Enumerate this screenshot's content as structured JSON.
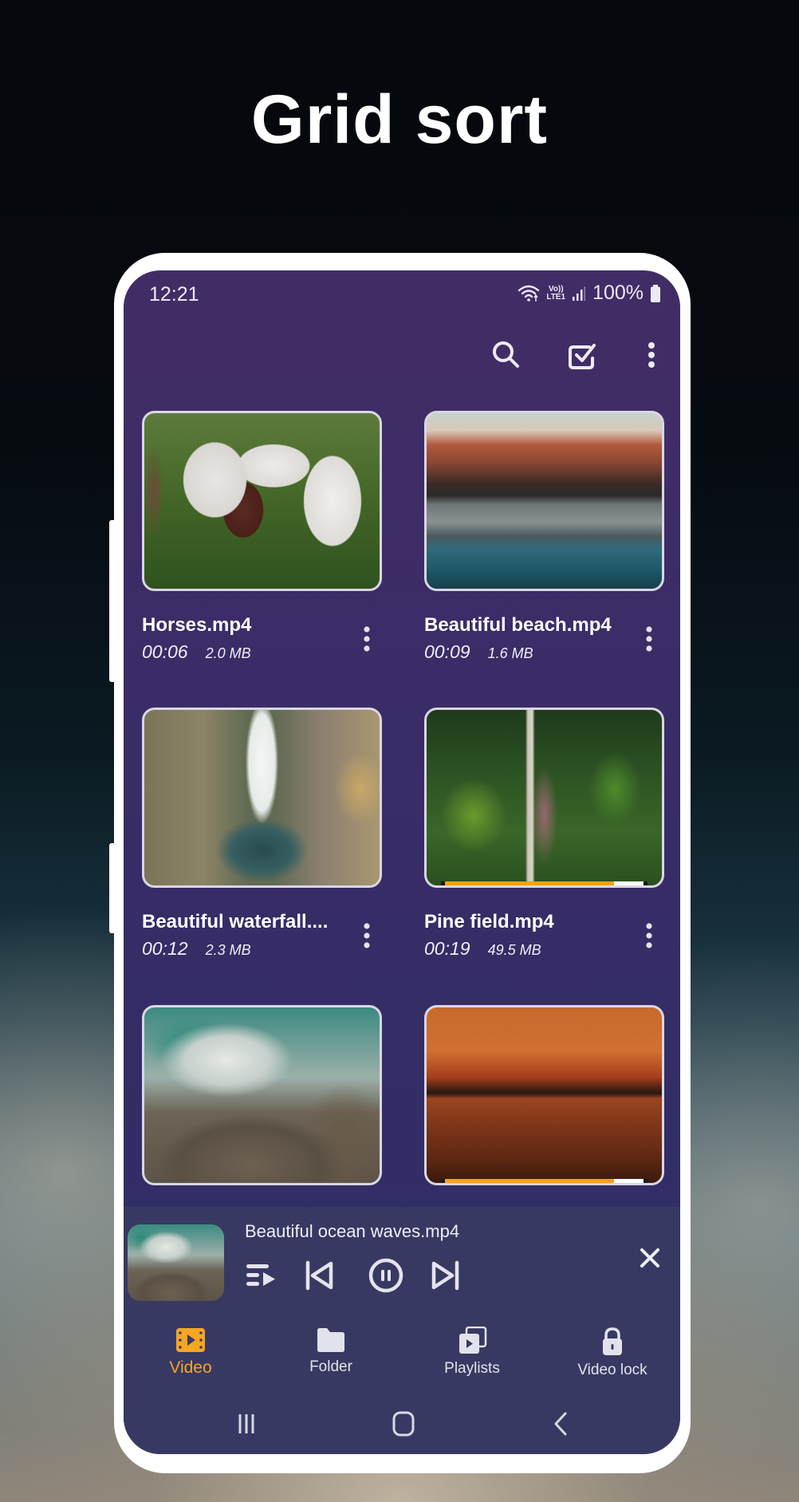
{
  "headline": "Grid sort",
  "status_bar": {
    "time": "12:21",
    "network_label_top": "Vo))",
    "network_label_bottom": "LTE1",
    "battery": "100%"
  },
  "toolbar": {
    "icons": [
      "search-icon",
      "select-checkbox-icon",
      "more-vert-icon"
    ]
  },
  "videos": [
    {
      "title": "Horses.mp4",
      "duration": "00:06",
      "size": "2.0 MB",
      "thumbnail": "horses-grazing",
      "progress": null
    },
    {
      "title": "Beautiful beach.mp4",
      "duration": "00:09",
      "size": "1.6 MB",
      "thumbnail": "coastal-city-mountains",
      "progress": null
    },
    {
      "title": "Beautiful waterfall....",
      "duration": "00:12",
      "size": "2.3 MB",
      "thumbnail": "waterfall-aerial",
      "progress": null
    },
    {
      "title": "Pine field.mp4",
      "duration": "00:19",
      "size": "49.5 MB",
      "thumbnail": "forest-road-aerial",
      "progress": 0.85
    },
    {
      "title": "",
      "duration": "",
      "size": "",
      "thumbnail": "ocean-waves-rocks",
      "progress": null
    },
    {
      "title": "",
      "duration": "",
      "size": "",
      "thumbnail": "sunset-sea",
      "progress": 0.85
    }
  ],
  "mini_player": {
    "title": "Beautiful ocean waves.mp4",
    "thumbnail": "ocean-waves-rocks",
    "controls": [
      "playlist-queue-icon",
      "skip-previous-icon",
      "pause-icon",
      "skip-next-icon"
    ],
    "close": "close-icon"
  },
  "bottom_nav": {
    "items": [
      {
        "label": "Video",
        "icon": "video-film-icon",
        "active": true
      },
      {
        "label": "Folder",
        "icon": "folder-icon",
        "active": false
      },
      {
        "label": "Playlists",
        "icon": "playlists-icon",
        "active": false
      },
      {
        "label": "Video lock",
        "icon": "lock-icon",
        "active": false
      }
    ]
  },
  "system_nav": [
    "recents-icon",
    "home-icon",
    "back-icon"
  ],
  "colors": {
    "accent": "#f5a623",
    "screen_bg": "#3a2c67",
    "player_bg": "#383962",
    "text": "#ffffff"
  }
}
